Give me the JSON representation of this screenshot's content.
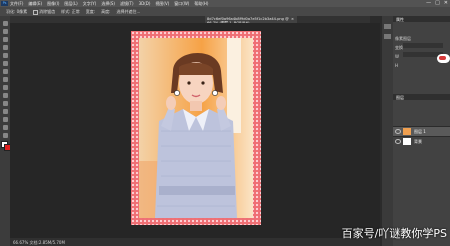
{
  "app": {
    "logo": "Ps"
  },
  "menu": [
    "文件(F)",
    "编辑(E)",
    "图像(I)",
    "图层(L)",
    "文字(Y)",
    "选择(S)",
    "滤镜(T)",
    "3D(D)",
    "视图(V)",
    "窗口(W)",
    "帮助(H)"
  ],
  "window_controls": [
    "—",
    "□",
    "✕"
  ],
  "options_bar": {
    "items": [
      "羽化: 0像素",
      "消除锯齿",
      "样式: 正常",
      "宽度:",
      "高度:",
      "选择并遮住..."
    ]
  },
  "document_tab": {
    "title": "8d7c6ef0a96a4b8f9d0a7e5f1c2b3a44.png @ 66.7% (图层 1, RGB/8#)",
    "close": "×"
  },
  "panels": {
    "adjustments_title": "属性",
    "rows": [
      "像素图层",
      "变换",
      "W",
      "H"
    ],
    "layers_title": "图层",
    "layers": [
      {
        "name": "图层 1",
        "selected": true
      },
      {
        "name": "背景",
        "selected": false
      }
    ]
  },
  "status": {
    "text": "66.67%   文档:2.85M/5.70M"
  },
  "watermark": "百家号/吖谜教你学PS",
  "colors": {
    "foreground": "#ffffff",
    "background": "#e0201e",
    "photo_border": "#e8636a",
    "panel_bg": "#424242"
  }
}
